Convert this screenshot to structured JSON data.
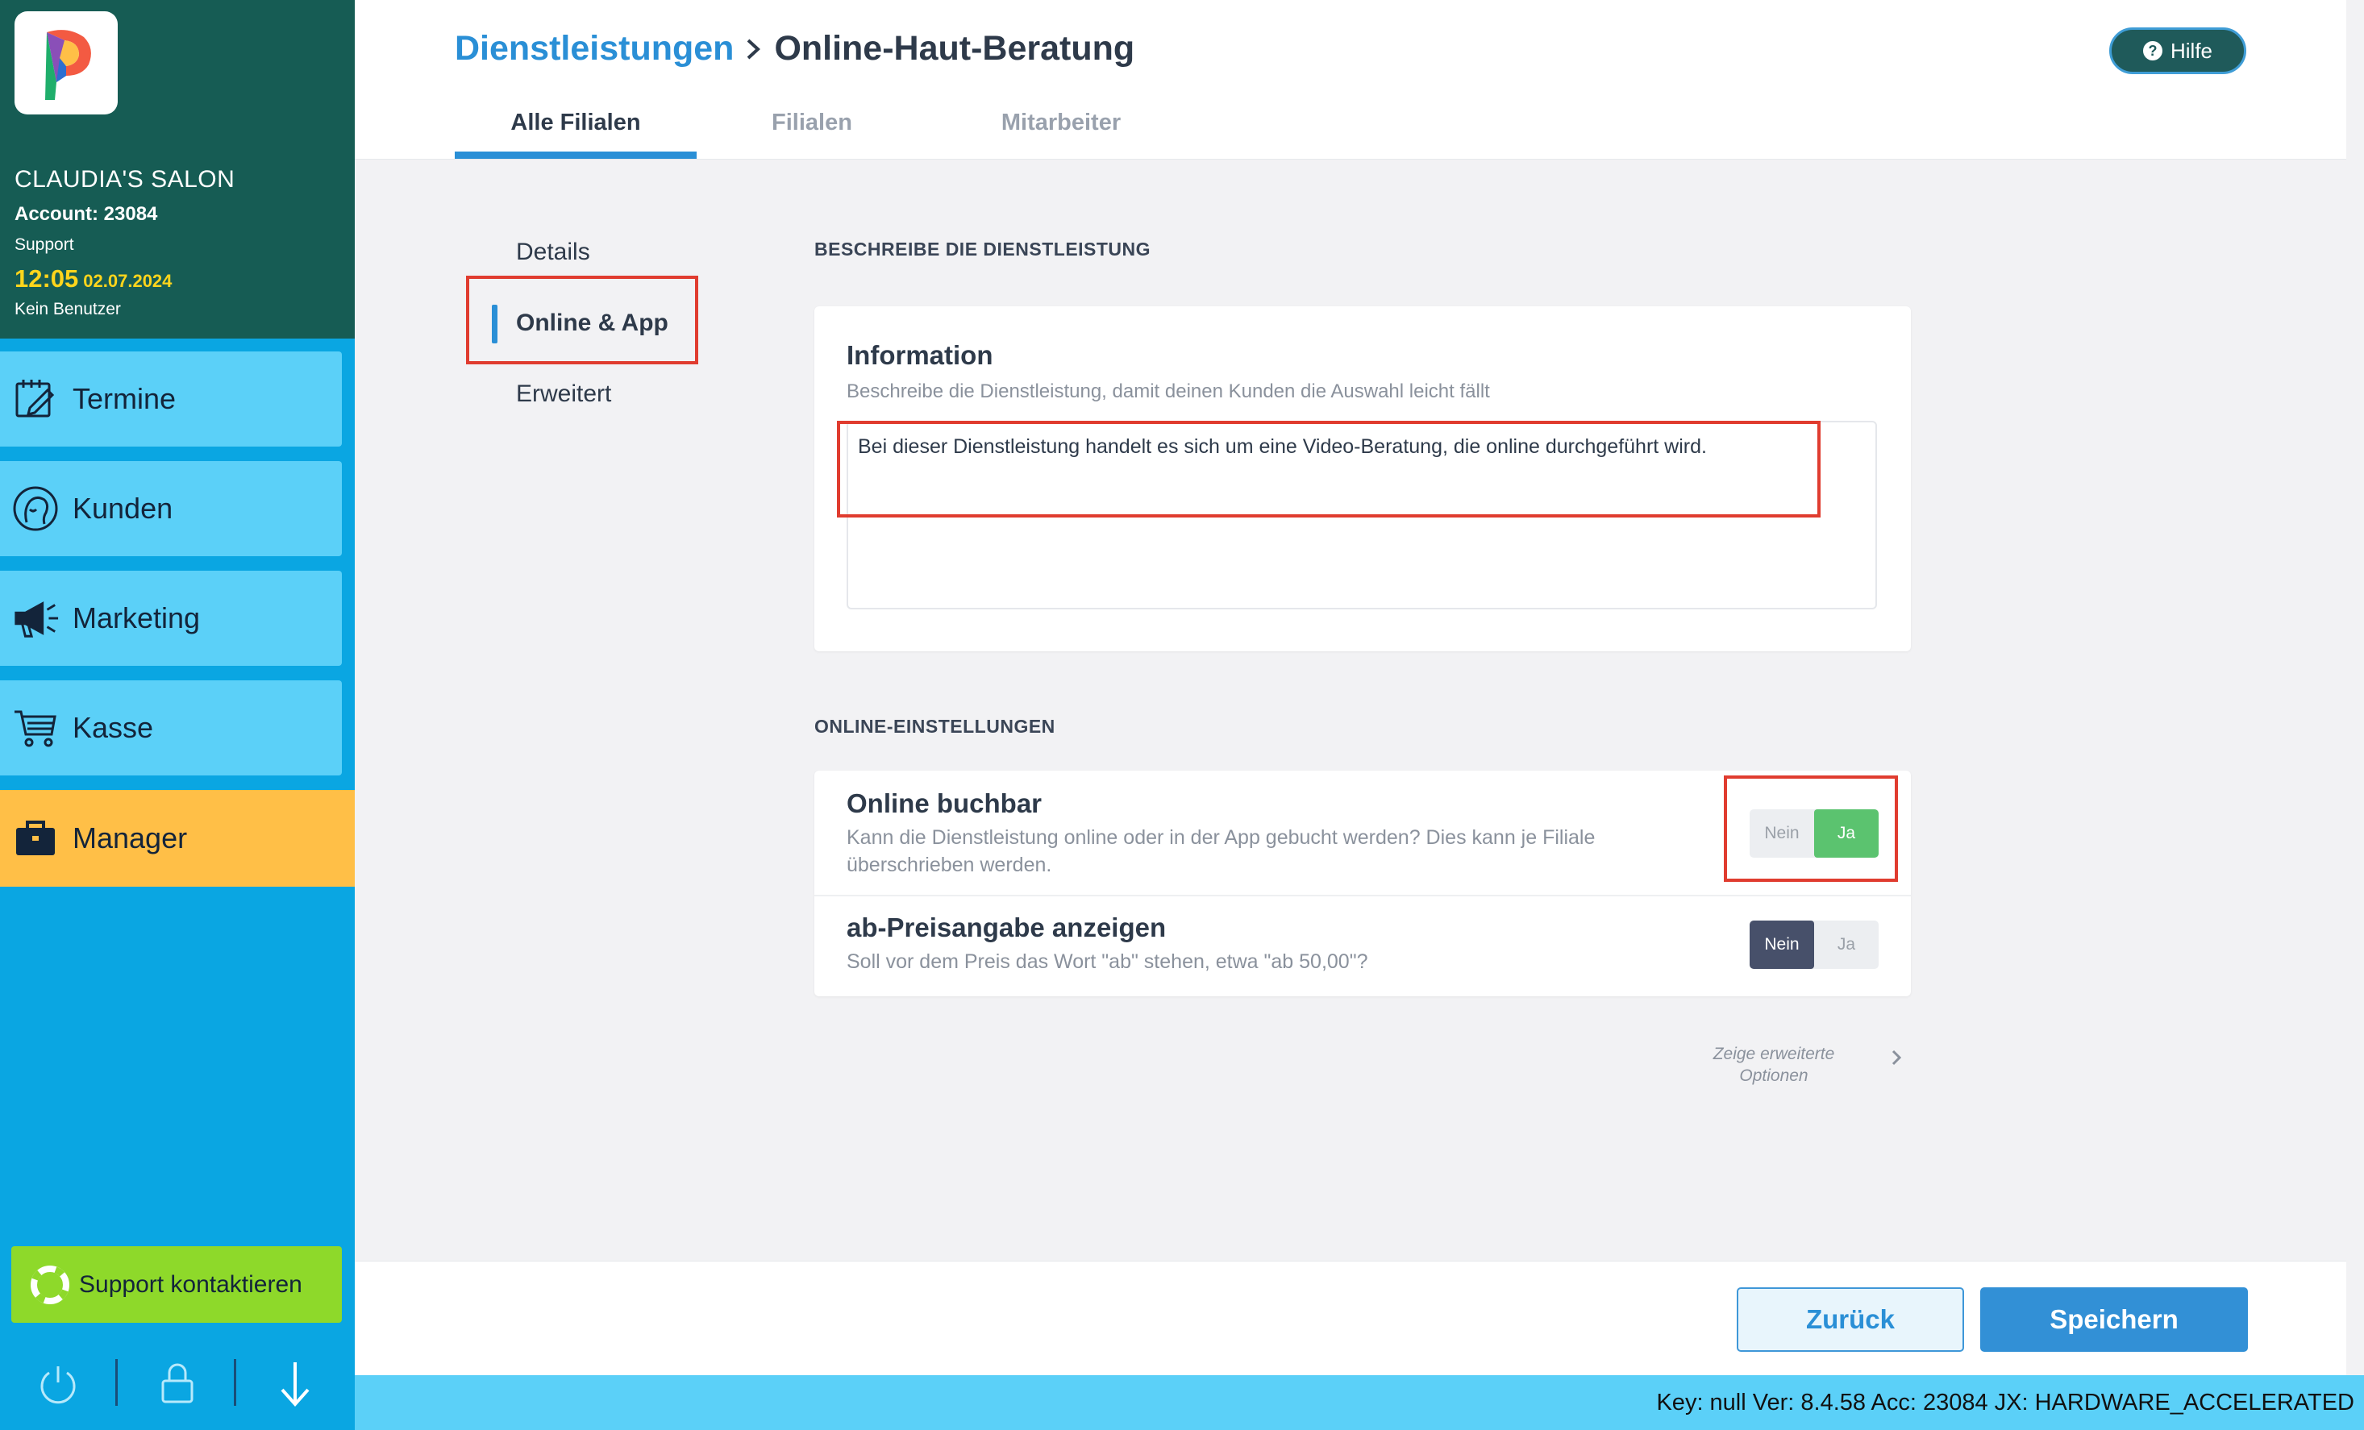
{
  "sidebar": {
    "salon_name": "CLAUDIA'S SALON",
    "account": "Account: 23084",
    "role": "Support",
    "time": "12:05",
    "date": "02.07.2024",
    "user": "Kein Benutzer",
    "nav": [
      {
        "label": "Termine",
        "icon": "calendar-edit-icon"
      },
      {
        "label": "Kunden",
        "icon": "customer-head-icon"
      },
      {
        "label": "Marketing",
        "icon": "megaphone-icon"
      },
      {
        "label": "Kasse",
        "icon": "shopping-cart-icon"
      },
      {
        "label": "Manager",
        "icon": "briefcase-icon"
      }
    ],
    "support_button": "Support kontaktieren",
    "bottom_icons": [
      "power-icon",
      "lock-icon",
      "download-arrow-icon"
    ]
  },
  "header": {
    "breadcrumb_link": "Dienstleistungen",
    "breadcrumb_current": "Online-Haut-Beratung",
    "help_label": "Hilfe",
    "tabs": [
      {
        "label": "Alle Filialen",
        "active": true
      },
      {
        "label": "Filialen",
        "active": false
      },
      {
        "label": "Mitarbeiter",
        "active": false
      }
    ]
  },
  "subnav": [
    {
      "label": "Details",
      "active": false
    },
    {
      "label": "Online & App",
      "active": true
    },
    {
      "label": "Erweitert",
      "active": false
    }
  ],
  "describe_section": {
    "title": "BESCHREIBE DIE DIENSTLEISTUNG",
    "card_title": "Information",
    "card_desc": "Beschreibe die Dienstleistung, damit deinen Kunden die Auswahl leicht fällt",
    "text_value": "Bei dieser Dienstleistung handelt es sich um eine Video-Beratung, die online durchgeführt wird."
  },
  "online_section": {
    "title": "ONLINE-EINSTELLUNGEN",
    "options": [
      {
        "title": "Online buchbar",
        "desc": "Kann die Dienstleistung online oder in der App gebucht werden? Dies kann je Filiale überschrieben werden.",
        "no_label": "Nein",
        "yes_label": "Ja",
        "selected": "Ja"
      },
      {
        "title": "ab-Preisangabe anzeigen",
        "desc": "Soll vor dem Preis das Wort \"ab\" stehen, etwa \"ab 50,00\"?",
        "no_label": "Nein",
        "yes_label": "Ja",
        "selected": "Nein"
      }
    ],
    "advanced_line1": "Zeige erweiterte",
    "advanced_line2": "Optionen"
  },
  "footer": {
    "back_label": "Zurück",
    "save_label": "Speichern"
  },
  "status_bar": "Key: null Ver: 8.4.58 Acc: 23084  JX: HARDWARE_ACCELERATED",
  "colors": {
    "sidebar_top": "#165c54",
    "sidebar_bg": "#0aa6e2",
    "nav_item": "#5bd0f8",
    "manager_active": "#ffbf47",
    "support_green": "#8ed92a",
    "accent_blue": "#2a8fd6",
    "toggle_yes": "#5bc36f",
    "toggle_no": "#47506a",
    "highlight_red": "#e03c2f"
  }
}
